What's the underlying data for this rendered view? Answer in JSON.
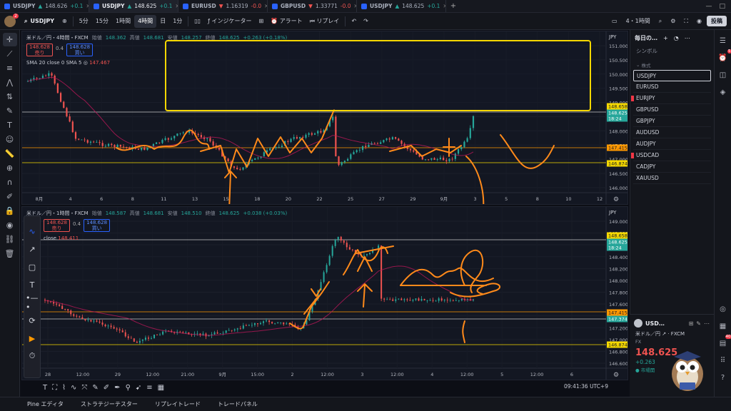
{
  "browser_tabs": [
    {
      "symbol": "USDJPY",
      "arrow": "▲",
      "price": "148.626",
      "change": "+0.1",
      "dir": "up",
      "active": false
    },
    {
      "symbol": "USDJPY",
      "arrow": "▲",
      "price": "148.625",
      "change": "+0.1",
      "dir": "up",
      "active": true
    },
    {
      "symbol": "EURUSD",
      "arrow": "▼",
      "price": "1.16319",
      "change": "-0.0",
      "dir": "dn",
      "active": false
    },
    {
      "symbol": "GBPUSD",
      "arrow": "▼",
      "price": "1.33771",
      "change": "-0.0",
      "dir": "dn",
      "active": false
    },
    {
      "symbol": "USDJPY",
      "arrow": "▲",
      "price": "148.625",
      "change": "+0.1",
      "dir": "up",
      "active": false
    }
  ],
  "toolbar": {
    "avatar_badge": "2",
    "symbol": "USDJPY",
    "intervals": [
      "5分",
      "15分",
      "1時間",
      "4時間",
      "日",
      "1分"
    ],
    "selected_interval": "4時間",
    "indicators_label": "インジケーター",
    "alert_label": "アラート",
    "replay_label": "リプレイ",
    "layout_label": "4・1時間",
    "post_label": "投稿"
  },
  "top_chart": {
    "title": "米ドル／円・4時間・FXCM",
    "open_label": "始値",
    "open": "148.362",
    "high_label": "高値",
    "high": "148.681",
    "low_label": "安値",
    "low": "148.257",
    "close_label": "終値",
    "close": "148.625",
    "change": "+0.263 (+0.18%)",
    "sell_price": "148.628",
    "sell_label": "売り",
    "spread": "0.4",
    "buy_price": "148.628",
    "buy_label": "買い",
    "sma_label": "SMA 20 close 0 SMA 5",
    "sma_value": "147.467",
    "currency": "JPY",
    "price_axis": [
      "151.000",
      "150.500",
      "150.000",
      "149.500",
      "149.000",
      "148.500",
      "148.000",
      "147.500",
      "147.000",
      "146.500",
      "146.000"
    ],
    "price_tags": [
      {
        "value": "148.658",
        "color": "#f5d800",
        "text": "#131722"
      },
      {
        "value": "148.625",
        "color": "#26a69a",
        "text": "#ffffff"
      },
      {
        "value": "18:24",
        "color": "#26a69a",
        "text": "#ffffff"
      },
      {
        "value": "147.415",
        "color": "#ff9800",
        "text": "#131722"
      },
      {
        "value": "146.874",
        "color": "#f5d800",
        "text": "#131722"
      }
    ],
    "time_axis": [
      "8月",
      "4",
      "6",
      "8",
      "11",
      "13",
      "15",
      "18",
      "20",
      "22",
      "25",
      "27",
      "29",
      "9月",
      "3",
      "5",
      "8",
      "10",
      "12"
    ]
  },
  "bottom_chart": {
    "title": "米ドル／円・1時間・FXCM",
    "open_label": "始値",
    "open": "148.587",
    "high_label": "高値",
    "high": "148.681",
    "low_label": "安値",
    "low": "148.510",
    "close_label": "終値",
    "close": "148.625",
    "change": "+0.038 (+0.03%)",
    "sell_price": "148.628",
    "sell_label": "売り",
    "spread": "0.4",
    "buy_price": "148.628",
    "buy_label": "買い",
    "sma_label": "close",
    "sma_value": "148.411",
    "currency": "JPY",
    "price_axis": [
      "149.000",
      "148.800",
      "148.600",
      "148.400",
      "148.200",
      "148.000",
      "147.800",
      "147.600",
      "147.400",
      "147.200",
      "147.000",
      "146.800",
      "146.600"
    ],
    "price_tags": [
      {
        "value": "148.658",
        "color": "#f5d800",
        "text": "#131722"
      },
      {
        "value": "148.625",
        "color": "#26a69a",
        "text": "#ffffff"
      },
      {
        "value": "18:24",
        "color": "#26a69a",
        "text": "#ffffff"
      },
      {
        "value": "147.415",
        "color": "#ff9800",
        "text": "#131722"
      },
      {
        "value": "147.374",
        "color": "#26a69a",
        "text": "#ffffff"
      },
      {
        "value": "146.874",
        "color": "#f5d800",
        "text": "#131722"
      }
    ],
    "time_axis": [
      "28",
      "12:00",
      "29",
      "12:00",
      "21:00",
      "9月",
      "15:00",
      "2",
      "12:00",
      "3",
      "12:00",
      "4",
      "12:00",
      "5",
      "12:00",
      "6"
    ]
  },
  "clock": "09:41:36 UTC+9",
  "bottom_panel": [
    "Pine エディタ",
    "ストラテジーテスター",
    "リプレイトレード",
    "トレードパネル"
  ],
  "watchlist": {
    "title": "毎日の…",
    "col_header": "シンボル",
    "section": "株式",
    "items": [
      "USDJPY",
      "EURUSD",
      "EURJPY",
      "GBPUSD",
      "GBPJPY",
      "AUDUSD",
      "AUDJPY",
      "USDCAD",
      "CADJPY",
      "XAUUSD"
    ],
    "selected": "USDJPY",
    "flagged": [
      "EURJPY",
      "USDCAD"
    ]
  },
  "detail": {
    "symbol": "USD…",
    "name": "米ドル／円",
    "exchange": "FXCM",
    "type": "FX",
    "price": "148.625",
    "change": "+0.263",
    "market_status": "市場開"
  },
  "rail_badges": {
    "alerts": "5",
    "news": "40"
  },
  "colors": {
    "up": "#26a69a",
    "down": "#ef5350",
    "accent": "#2962ff",
    "drawing": "#ff8a1a",
    "highlight": "#f5d800"
  }
}
